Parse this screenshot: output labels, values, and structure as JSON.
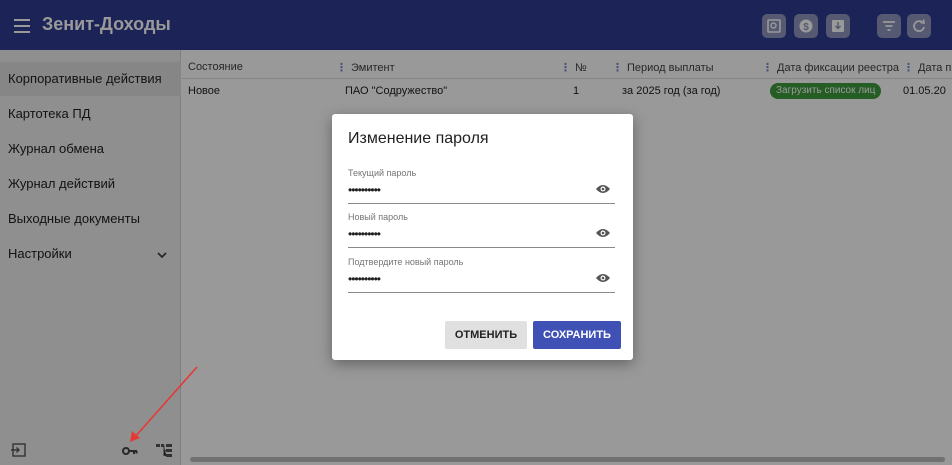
{
  "app": {
    "title": "Зенит-Доходы"
  },
  "colors": {
    "header": "#2f3b8f",
    "accent": "#3f51b5",
    "success": "#3e9b3e",
    "annotation": "#e53935"
  },
  "header_icons": [
    "search-doc-icon",
    "dollar-icon",
    "download-doc-icon",
    "filter-icon",
    "refresh-icon"
  ],
  "sidebar": {
    "items": [
      {
        "label": "Корпоративные действия"
      },
      {
        "label": "Картотека ПД"
      },
      {
        "label": "Журнал обмена"
      },
      {
        "label": "Журнал действий"
      },
      {
        "label": "Выходные документы"
      },
      {
        "label": "Настройки"
      }
    ],
    "footer_icons": [
      "logout-icon",
      "key-icon",
      "tree-icon"
    ]
  },
  "table": {
    "columns": [
      "Состояние",
      "Эмитент",
      "№",
      "Период выплаты",
      "Дата фиксации реестра",
      "Дата пр"
    ],
    "rows": [
      {
        "state": "Новое",
        "issuer": "ПАО \"Содружество\"",
        "number": "1",
        "period": "за 2025 год (за год)",
        "action": "Загрузить список лиц",
        "date": "01.05.20"
      }
    ]
  },
  "dialog": {
    "title": "Изменение пароля",
    "fields": [
      {
        "label": "Текущий пароль",
        "value": "••••••••••"
      },
      {
        "label": "Новый пароль",
        "value": "••••••••••"
      },
      {
        "label": "Подтвердите новый пароль",
        "value": "••••••••••"
      }
    ],
    "cancel": "ОТМЕНИТЬ",
    "save": "СОХРАНИТЬ"
  }
}
